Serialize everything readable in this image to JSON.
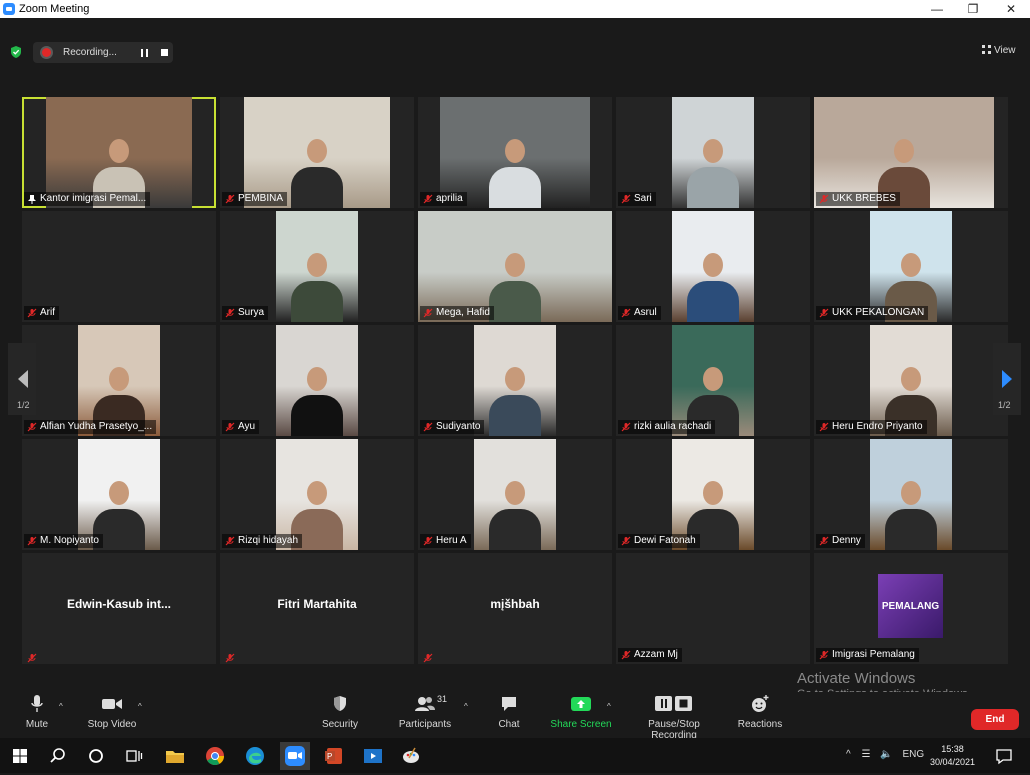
{
  "window": {
    "title": "Zoom Meeting",
    "controls": [
      "minimize",
      "maximize",
      "close"
    ]
  },
  "meeting_header": {
    "recording_label": "Recording...",
    "view_label": "View"
  },
  "gallery": {
    "page_left": "1/2",
    "page_right": "1/2",
    "tiles": [
      {
        "name": "Kantor imigrasi Pemal...",
        "active": true,
        "video": true
      },
      {
        "name": "PEMBINA",
        "video": true
      },
      {
        "name": "aprilia",
        "video": true
      },
      {
        "name": "Sari",
        "video": true
      },
      {
        "name": "UKK BREBES",
        "video": true
      },
      {
        "name": "Arif",
        "video": false
      },
      {
        "name": "Surya",
        "video": true
      },
      {
        "name": "Mega, Hafid",
        "video": true
      },
      {
        "name": "Asrul",
        "video": true
      },
      {
        "name": "UKK PEKALONGAN",
        "video": true
      },
      {
        "name": "Alfian Yudha Prasetyo_...",
        "video": true
      },
      {
        "name": "Ayu",
        "video": true
      },
      {
        "name": "Sudiyanto",
        "video": true
      },
      {
        "name": "rizki aulia rachadi",
        "video": true
      },
      {
        "name": "Heru Endro Priyanto",
        "video": true
      },
      {
        "name": "M. Nopiyanto",
        "video": true
      },
      {
        "name": "Rizqi hidayah",
        "video": true
      },
      {
        "name": "Heru A",
        "video": true
      },
      {
        "name": "Dewi Fatonah",
        "video": true
      },
      {
        "name": "Denny",
        "video": true
      },
      {
        "name": "Edwin-Kasub  int...",
        "video": false,
        "center_name": true
      },
      {
        "name": "Fitri Martahita",
        "video": false,
        "center_name": true
      },
      {
        "name": "mįšhbah",
        "video": false,
        "center_name": true
      },
      {
        "name": "Azzam Mj",
        "video": false
      },
      {
        "name": "Imigrasi Pemalang",
        "video": false,
        "logo": true,
        "logo_text": "PEMALANG"
      }
    ]
  },
  "toolbar": {
    "mute": "Mute",
    "stop_video": "Stop Video",
    "security": "Security",
    "participants": "Participants",
    "participants_count": "31",
    "chat": "Chat",
    "share_screen": "Share Screen",
    "pause_stop_recording": "Pause/Stop Recording",
    "reactions": "Reactions",
    "end": "End"
  },
  "watermark": {
    "line1": "Activate Windows",
    "line2": "Go to Settings to activate Windows."
  },
  "taskbar": {
    "language": "ENG",
    "time": "15:38",
    "date": "30/04/2021"
  },
  "colors": {
    "active_speaker": "#c8e033",
    "end_button": "#e02828",
    "share_screen": "#23d959",
    "muted_mic": "#e02828"
  }
}
